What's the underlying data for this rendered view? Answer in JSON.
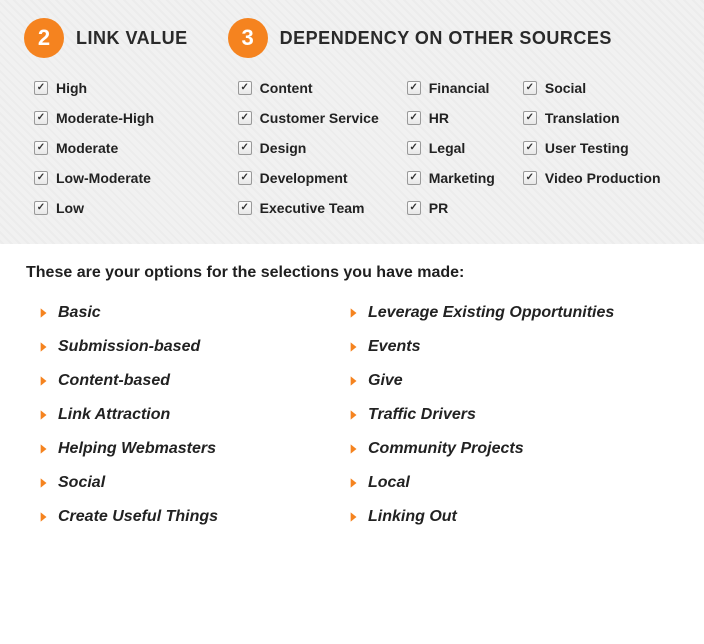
{
  "sections": {
    "link_value": {
      "badge": "2",
      "title": "LINK VALUE",
      "items": [
        "High",
        "Moderate-High",
        "Moderate",
        "Low-Moderate",
        "Low"
      ]
    },
    "dependency": {
      "badge": "3",
      "title": "DEPENDENCY ON OTHER SOURCES",
      "cols": [
        [
          "Content",
          "Customer Service",
          "Design",
          "Development",
          "Executive Team"
        ],
        [
          "Financial",
          "HR",
          "Legal",
          "Marketing",
          "PR"
        ],
        [
          "Social",
          "Translation",
          "User Testing",
          "Video Production"
        ]
      ]
    }
  },
  "results": {
    "heading": "These are your options for the selections you have made:",
    "col1": [
      "Basic",
      "Submission-based",
      "Content-based",
      "Link Attraction",
      "Helping Webmasters",
      "Social",
      "Create Useful Things"
    ],
    "col2": [
      "Leverage Existing Opportunities",
      "Events",
      "Give",
      "Traffic Drivers",
      "Community Projects",
      "Local",
      "Linking Out"
    ]
  }
}
